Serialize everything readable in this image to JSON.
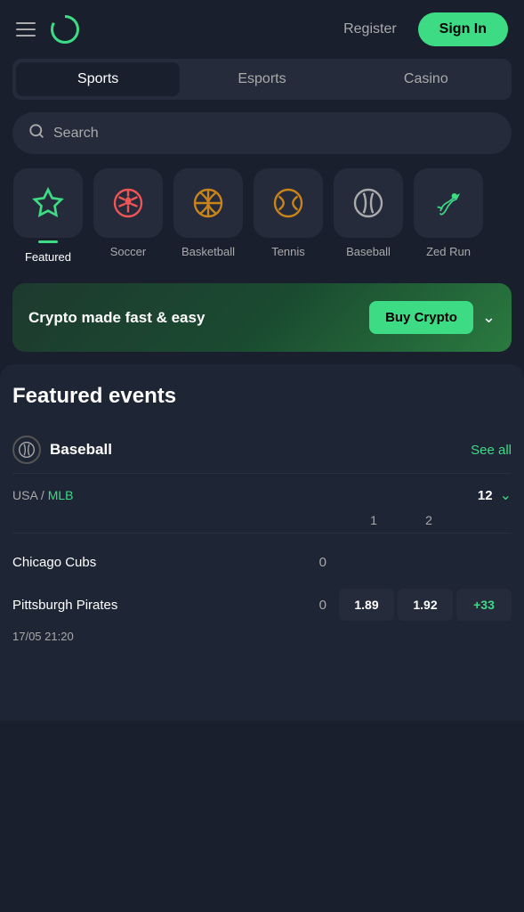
{
  "header": {
    "register_label": "Register",
    "signin_label": "Sign In"
  },
  "main_nav": {
    "tabs": [
      {
        "label": "Sports",
        "active": true
      },
      {
        "label": "Esports",
        "active": false
      },
      {
        "label": "Casino",
        "active": false
      }
    ]
  },
  "search": {
    "placeholder": "Search"
  },
  "sports_categories": [
    {
      "label": "Featured",
      "icon": "⭐",
      "active": true,
      "color": "#3ddc84"
    },
    {
      "label": "Soccer",
      "icon": "⚽",
      "active": false
    },
    {
      "label": "Basketball",
      "icon": "🏀",
      "active": false
    },
    {
      "label": "Tennis",
      "icon": "🎾",
      "active": false
    },
    {
      "label": "Baseball",
      "icon": "⚾",
      "active": false
    },
    {
      "label": "Zed Run",
      "icon": "🐴",
      "active": false
    }
  ],
  "crypto_banner": {
    "text": "Crypto made fast & easy",
    "buy_label": "Buy Crypto"
  },
  "featured_section": {
    "title": "Featured events",
    "sport": {
      "name": "Baseball",
      "see_all": "See all",
      "league": {
        "prefix": "USA",
        "name": "MLB",
        "count": 12
      },
      "col_headers": [
        "1",
        "2"
      ],
      "matches": [
        {
          "team1": "Chicago Cubs",
          "team2": "Pittsburgh Pirates",
          "score1": "0",
          "score2": "0",
          "odds": [
            "1.89",
            "1.92",
            "+33"
          ],
          "time": "17/05 21:20"
        }
      ]
    }
  }
}
